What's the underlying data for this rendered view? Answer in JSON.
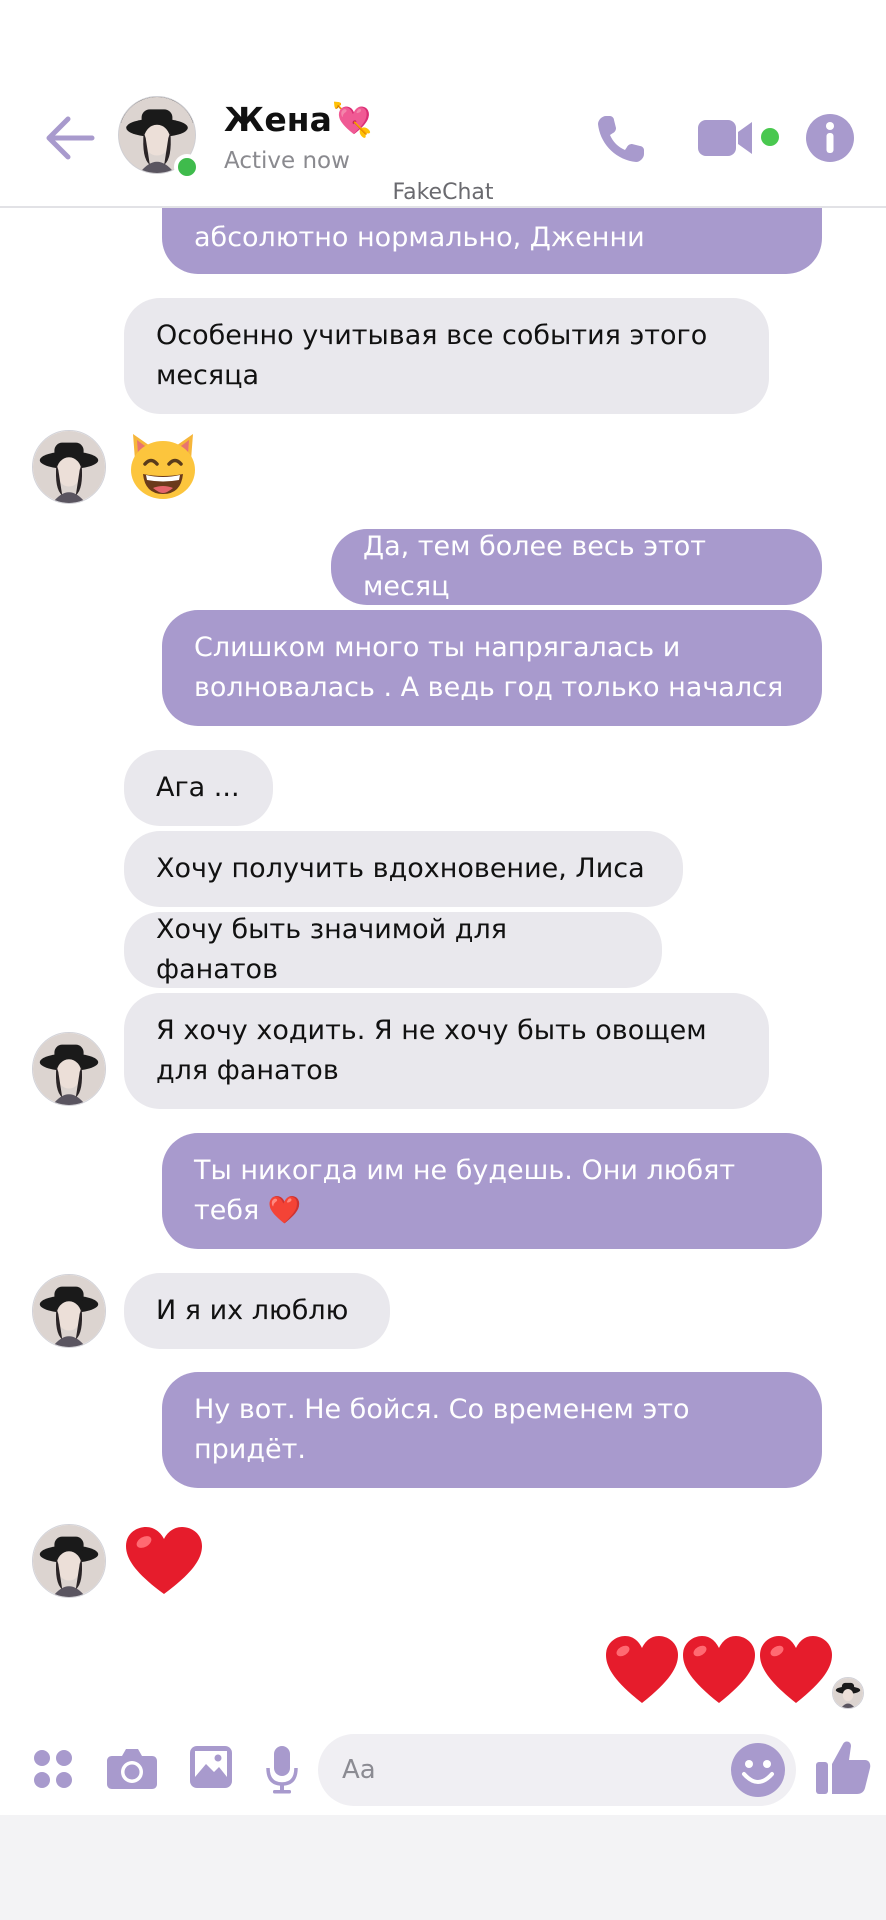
{
  "header": {
    "contact_name": "Жена💘",
    "status": "Active now",
    "watermark": "FakeChat"
  },
  "messages": [
    {
      "side": "out",
      "text": "абсолютно нормально, Дженни"
    },
    {
      "side": "in",
      "text": "Особенно учитывая все события этого месяца"
    },
    {
      "side": "in",
      "emoji": "grinning-cat-emoji"
    },
    {
      "side": "out",
      "text": "Да, тем более весь этот месяц"
    },
    {
      "side": "out",
      "text": "Слишком много ты напрягалась и волновалась . А ведь год только начался"
    },
    {
      "side": "in",
      "text": "Ага ..."
    },
    {
      "side": "in",
      "text": "Хочу получить вдохновение, Лиса"
    },
    {
      "side": "in",
      "text": "Хочу быть значимой для фанатов"
    },
    {
      "side": "in",
      "text": "Я хочу ходить.  Я не хочу быть овощем для фанатов"
    },
    {
      "side": "out",
      "text": "Ты никогда им не будешь. Они любят тебя ❤️"
    },
    {
      "side": "in",
      "text": "И я их люблю"
    },
    {
      "side": "out",
      "text": "Ну вот. Не бойся. Со временем это придёт."
    },
    {
      "side": "in",
      "emoji": "red-heart-emoji"
    },
    {
      "side": "out",
      "emoji": "three-red-hearts-emoji"
    }
  ],
  "composer": {
    "placeholder": "Aa",
    "icons": [
      "apps-grid-icon",
      "camera-icon",
      "gallery-icon",
      "microphone-icon",
      "emoji-icon",
      "thumbs-up-icon"
    ]
  },
  "colors": {
    "accent": "#a89acd",
    "incoming_bubble": "#e9e8ed",
    "online": "#3fbb4c"
  }
}
